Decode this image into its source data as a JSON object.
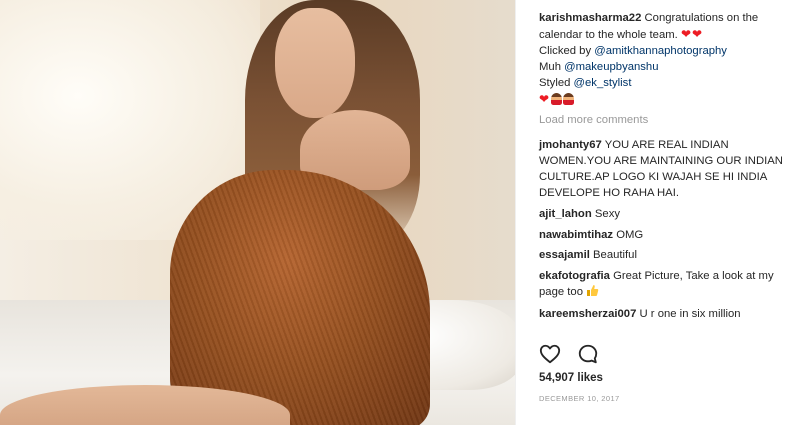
{
  "post": {
    "author": "karishmasharma22",
    "caption_lines": [
      "Congratulations on the",
      "calendar to the whole team."
    ],
    "credits": [
      {
        "prefix": "Clicked by",
        "mention": "@amitkhannaphotography"
      },
      {
        "prefix": "Muh",
        "mention": "@makeupbyanshu"
      },
      {
        "prefix": "Styled",
        "mention": "@ek_stylist"
      }
    ]
  },
  "load_more_label": "Load more comments",
  "comments": [
    {
      "user": "jmohanty67",
      "text": "YOU ARE REAL INDIAN WOMEN.YOU ARE MAINTAINING OUR INDIAN CULTURE.AP LOGO KI WAJAH SE HI INDIA DEVELOPE HO RAHA HAI."
    },
    {
      "user": "ajit_lahon",
      "text": "Sexy"
    },
    {
      "user": "nawabimtihaz",
      "text": "OMG"
    },
    {
      "user": "essajamil",
      "text": "Beautiful"
    },
    {
      "user": "ekafotografia",
      "text": "Great Picture, Take a look at my page too"
    },
    {
      "user": "kareemsherzai007",
      "text": "U r one in six million"
    }
  ],
  "likes": "54,907 likes",
  "date": "DECEMBER 10, 2017",
  "colors": {
    "heart": "#ed1c24",
    "mention": "#003569",
    "muted": "#999999",
    "text": "#262626"
  },
  "icons": {
    "like": "heart-outline-icon",
    "comment": "speech-bubble-icon"
  }
}
